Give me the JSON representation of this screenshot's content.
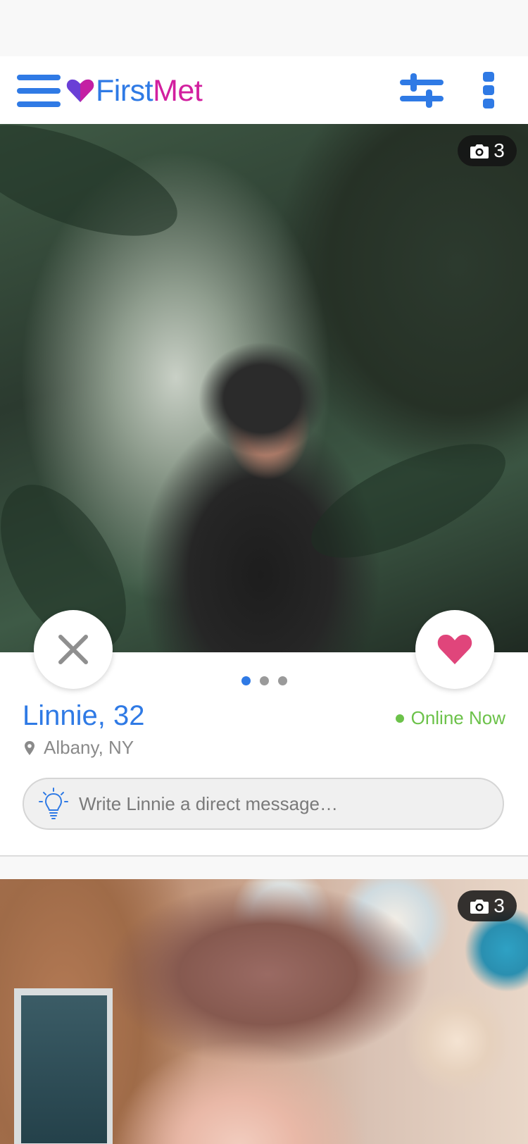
{
  "app": {
    "brand_first": "First",
    "brand_second": "Met",
    "colors": {
      "brand_blue": "#2f7ae5",
      "brand_magenta": "#d21f9f",
      "like_pink": "#e0457b",
      "online_green": "#6cc24a"
    }
  },
  "header": {
    "menu_icon": "hamburger-menu-icon",
    "filter_icon": "sliders-icon",
    "more_icon": "vertical-dots-icon"
  },
  "profiles": [
    {
      "photo_count": "3",
      "name_age": "Linnie, 32",
      "status": "Online Now",
      "location": "Albany, NY",
      "message_placeholder": "Write Linnie a direct message…",
      "carousel": {
        "total": 3,
        "active": 1
      }
    },
    {
      "photo_count": "3"
    }
  ]
}
